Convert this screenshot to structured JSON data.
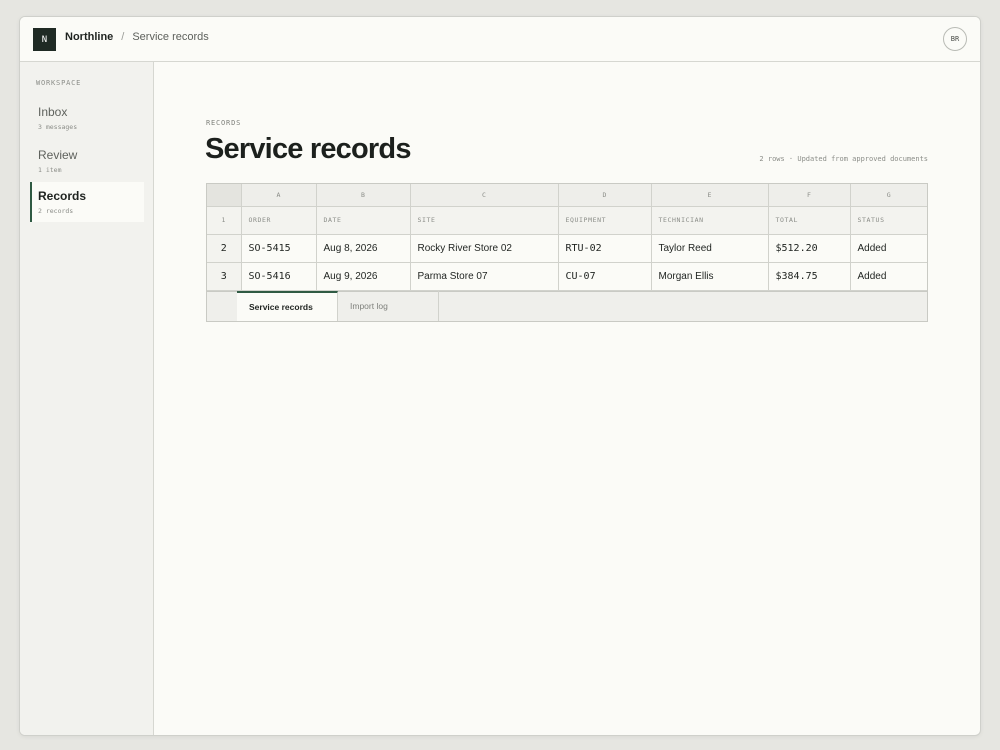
{
  "header": {
    "logo_letter": "N",
    "app_name": "Northline",
    "separator": "/",
    "page_name": "Service records",
    "avatar_initials": "BR"
  },
  "sidebar": {
    "heading": "WORKSPACE",
    "items": [
      {
        "label": "Inbox",
        "sub": "3 messages",
        "active": false
      },
      {
        "label": "Review",
        "sub": "1 item",
        "active": false
      },
      {
        "label": "Records",
        "sub": "2 records",
        "active": true
      }
    ]
  },
  "main": {
    "eyebrow": "RECORDS",
    "title": "Service records",
    "summary": "2 rows · Updated from approved documents"
  },
  "sheet": {
    "column_letters": [
      "A",
      "B",
      "C",
      "D",
      "E",
      "F",
      "G"
    ],
    "header_row_number": "1",
    "headers": [
      "ORDER",
      "DATE",
      "SITE",
      "EQUIPMENT",
      "TECHNICIAN",
      "TOTAL",
      "STATUS"
    ],
    "rows": [
      {
        "row_number": "2",
        "order": "SO-5415",
        "date": "Aug 8, 2026",
        "site": "Rocky River Store 02",
        "equipment": "RTU-02",
        "technician": "Taylor Reed",
        "total": "$512.20",
        "status": "Added"
      },
      {
        "row_number": "3",
        "order": "SO-5416",
        "date": "Aug 9, 2026",
        "site": "Parma Store 07",
        "equipment": "CU-07",
        "technician": "Morgan Ellis",
        "total": "$384.75",
        "status": "Added"
      }
    ],
    "tabs": [
      {
        "label": "Service records",
        "active": true
      },
      {
        "label": "Import log",
        "active": false
      }
    ]
  },
  "colors": {
    "accent": "#2f5a43",
    "logo_bg": "#1f2a24",
    "page_bg": "#fbfbf7",
    "sidebar_bg": "#f2f2ee"
  }
}
